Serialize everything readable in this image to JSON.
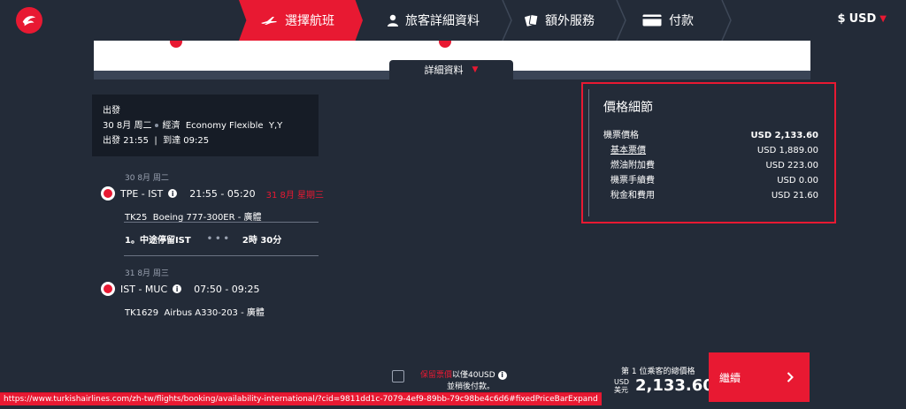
{
  "nav": {
    "steps": [
      {
        "label": "選擇航班",
        "icon": "plane-icon",
        "active": true
      },
      {
        "label": "旅客詳細資料",
        "icon": "person-icon",
        "active": false
      },
      {
        "label": "額外服務",
        "icon": "cards-icon",
        "active": false
      },
      {
        "label": "付款",
        "icon": "card-icon",
        "active": false
      }
    ],
    "currency_symbol": "$",
    "currency": "USD"
  },
  "details_tab": "詳細資料",
  "departure": {
    "title": "出發",
    "line1_date": "30 8月 周二",
    "line1_cabin": "經濟",
    "line1_fare": "Economy Flexible",
    "line1_class": "Y,Y",
    "line2_dep_label": "出發",
    "line2_dep_time": "21:55",
    "line2_arr_label": "到達",
    "line2_arr_time": "09:25"
  },
  "segments": [
    {
      "date": "30 8月 周二",
      "route": "TPE - IST",
      "times": "21:55 - 05:20",
      "next_day": "31 8月 星期三",
      "flight": "TK25",
      "aircraft": "Boeing 777-300ER - 廣體"
    },
    {
      "date": "31 8月 周三",
      "route": "IST - MUC",
      "times": "07:50 - 09:25",
      "next_day": "",
      "flight": "TK1629",
      "aircraft": "Airbus A330-203 - 廣體"
    }
  ],
  "stopover": {
    "label": "1。中途停留IST",
    "duration": "2時 30分"
  },
  "price": {
    "title": "價格細節",
    "rows": [
      {
        "label": "機票價格",
        "value": "USD 2,133.60"
      },
      {
        "label": "基本票價",
        "value": "USD 1,889.00"
      },
      {
        "label": "燃油附加費",
        "value": "USD 223.00"
      },
      {
        "label": "機票手續費",
        "value": "USD 0.00"
      },
      {
        "label": "稅金和費用",
        "value": "USD 21.60"
      }
    ]
  },
  "hold": {
    "red": "保留票價",
    "white": "以僅40USD",
    "line2": "並稍後付款。"
  },
  "total": {
    "label": "第 1 位乘客的總價格",
    "usd": "USD",
    "usd_cn": "美元",
    "amount": "2,133.60"
  },
  "continue_label": "繼續",
  "status_url": "https://www.turkishairlines.com/zh-tw/flights/booking/availability-international/?cid=9811dd1c-7079-4ef9-89bb-79c98be4c6d6#fixedPriceBarExpand",
  "colors": {
    "accent": "#e81932",
    "background": "#232b38"
  }
}
